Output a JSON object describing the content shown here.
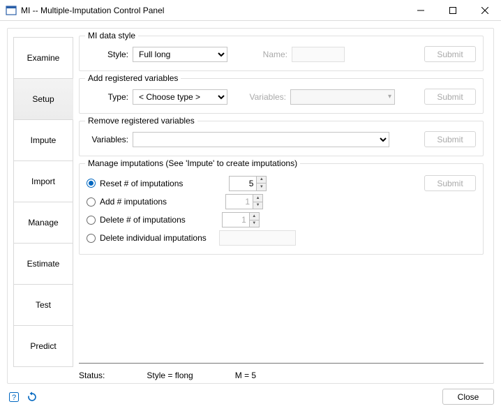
{
  "window": {
    "title": "MI -- Multiple-Imputation Control Panel"
  },
  "tabs": [
    "Examine",
    "Setup",
    "Impute",
    "Import",
    "Manage",
    "Estimate",
    "Test",
    "Predict"
  ],
  "selected_tab": "Setup",
  "data_style": {
    "legend": "MI data style",
    "style_label": "Style:",
    "style_value": "Full long",
    "name_label": "Name:",
    "name_value": "",
    "submit": "Submit"
  },
  "add_vars": {
    "legend": "Add registered variables",
    "type_label": "Type:",
    "type_value": "< Choose type >",
    "vars_label": "Variables:",
    "submit": "Submit"
  },
  "remove_vars": {
    "legend": "Remove registered variables",
    "vars_label": "Variables:",
    "submit": "Submit"
  },
  "manage": {
    "legend": "Manage imputations (See 'Impute' to create imputations)",
    "reset_label": "Reset # of imputations",
    "reset_value": "5",
    "add_label": "Add # imputations",
    "add_value": "1",
    "del_label": "Delete # of imputations",
    "del_value": "1",
    "del_indiv_label": "Delete individual imputations",
    "submit": "Submit"
  },
  "status": {
    "label": "Status:",
    "style": "Style =  flong",
    "m": "M =  5"
  },
  "footer": {
    "close": "Close"
  }
}
